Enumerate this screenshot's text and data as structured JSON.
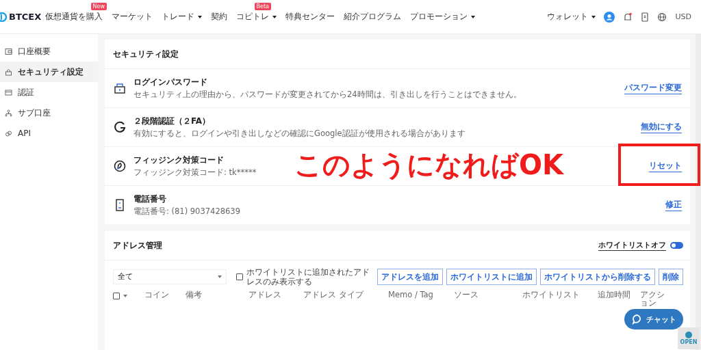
{
  "header": {
    "logo": "BTCEX",
    "nav": [
      {
        "label": "仮想通貨を購入",
        "badge": "New",
        "dropdown": false
      },
      {
        "label": "マーケット",
        "dropdown": false
      },
      {
        "label": "トレード",
        "dropdown": true
      },
      {
        "label": "契約",
        "dropdown": false
      },
      {
        "label": "コピトレ",
        "badge": "Beta",
        "dropdown": true
      },
      {
        "label": "特典センター",
        "dropdown": false
      },
      {
        "label": "紹介プログラム",
        "dropdown": false
      },
      {
        "label": "プロモーション",
        "dropdown": true
      }
    ],
    "wallet": "ウォレット",
    "currency": "USD"
  },
  "sidebar": {
    "items": [
      {
        "label": "口座概要",
        "selected": false
      },
      {
        "label": "セキュリティ設定",
        "selected": true
      },
      {
        "label": "認証",
        "selected": false
      },
      {
        "label": "サブ口座",
        "selected": false
      },
      {
        "label": "API",
        "selected": false
      }
    ]
  },
  "security": {
    "title": "セキュリティ設定",
    "rows": [
      {
        "title": "ログインパスワード",
        "description": "セキュリティ上の理由から、パスワードが変更されてから24時間は、引き出しを行うことはできません。",
        "action": "パスワード変更"
      },
      {
        "title": "２段階認証（２FA）",
        "description": "有効にすると、ログインや引き出しなどの確認にGoogle認証が使用される場合があります",
        "action": "無効にする"
      },
      {
        "title": "フィッジンク対策コード",
        "description": "フィッジンク対策コード: tk*****",
        "action": "リセット"
      },
      {
        "title": "電話番号",
        "description": "電話番号: (81) 9037428639",
        "action": "修正"
      }
    ]
  },
  "address": {
    "title": "アドレス管理",
    "whitelist_toggle": {
      "label": "ホワイトリストオフ",
      "on": false
    },
    "filter": {
      "value": "全て"
    },
    "whitelist_only": {
      "label": "ホワイトリストに追加されたアドレスのみ表示する",
      "checked": false
    },
    "buttons": [
      "アドレスを追加",
      "ホワイトリストに追加",
      "ホワイトリストから削除する",
      "削除"
    ],
    "table": {
      "select_all": {
        "checked": false
      },
      "columns": [
        "コイン",
        "備考",
        "アドレス",
        "アドレス タイプ",
        "Memo / Tag",
        "ソース",
        "ホワイトリスト",
        "追加時間",
        "アクション"
      ]
    }
  },
  "chat_button": "チャット",
  "open_badge": "OPEN",
  "annotation": {
    "text": "このようになればOK"
  }
}
